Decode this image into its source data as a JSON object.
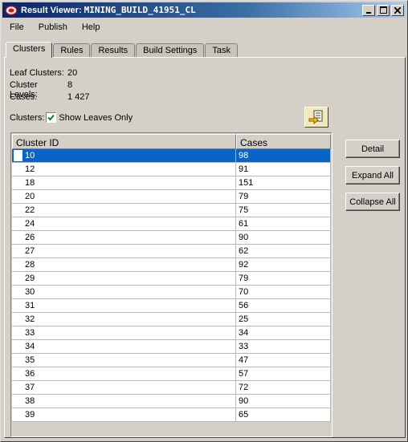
{
  "window": {
    "title_prefix": "Result Viewer: ",
    "title_name": "MINING_BUILD_41951_CL"
  },
  "menu": [
    {
      "label": "File"
    },
    {
      "label": "Publish"
    },
    {
      "label": "Help"
    }
  ],
  "tabs": [
    {
      "label": "Clusters",
      "active": true
    },
    {
      "label": "Rules"
    },
    {
      "label": "Results"
    },
    {
      "label": "Build Settings"
    },
    {
      "label": "Task"
    }
  ],
  "info": {
    "leaf_clusters_label": "Leaf Clusters:",
    "leaf_clusters_value": "20",
    "cluster_levels_label": "Cluster Levels:",
    "cluster_levels_value": "8",
    "cases_label": "Cases:",
    "cases_value": "1 427"
  },
  "filter": {
    "clusters_label": "Clusters:",
    "show_leaves_label": "Show Leaves Only",
    "show_leaves_checked": true
  },
  "table": {
    "columns": [
      "Cluster ID",
      "Cases"
    ],
    "rows": [
      {
        "id": "10",
        "cases": "98",
        "selected": true
      },
      {
        "id": "12",
        "cases": "91"
      },
      {
        "id": "18",
        "cases": "151"
      },
      {
        "id": "20",
        "cases": "79"
      },
      {
        "id": "22",
        "cases": "75"
      },
      {
        "id": "24",
        "cases": "61"
      },
      {
        "id": "26",
        "cases": "90"
      },
      {
        "id": "27",
        "cases": "62"
      },
      {
        "id": "28",
        "cases": "92"
      },
      {
        "id": "29",
        "cases": "79"
      },
      {
        "id": "30",
        "cases": "70"
      },
      {
        "id": "31",
        "cases": "56"
      },
      {
        "id": "32",
        "cases": "25"
      },
      {
        "id": "33",
        "cases": "34"
      },
      {
        "id": "34",
        "cases": "33"
      },
      {
        "id": "35",
        "cases": "47"
      },
      {
        "id": "36",
        "cases": "57"
      },
      {
        "id": "37",
        "cases": "72"
      },
      {
        "id": "38",
        "cases": "90"
      },
      {
        "id": "39",
        "cases": "65"
      }
    ]
  },
  "buttons": {
    "detail": "Detail",
    "expand_all": "Expand All",
    "collapse_all": "Collapse All"
  },
  "colors": {
    "selection": "#0a63c6",
    "titlebar": "#0a246a",
    "face": "#d4d0c8"
  }
}
